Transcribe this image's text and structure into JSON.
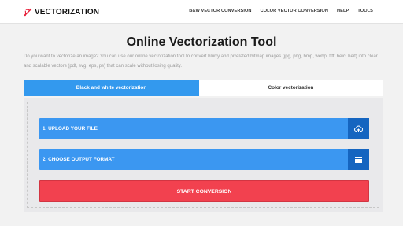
{
  "brand": {
    "name": "VECTORIZATION",
    "accent": "#e8203a"
  },
  "nav": {
    "items": [
      "B&W VECTOR CONVERSION",
      "COLOR VECTOR CONVERSION",
      "HELP",
      "TOOLS"
    ]
  },
  "main": {
    "title": "Online Vectorization Tool",
    "description": "Do you want to vectorize an image? You can use our online vectorization tool to convert blurry and pixelated bitmap images (jpg, png, bmp, webp, tiff, heic, heif) into clear and scalable vectors (pdf, svg, eps, ps) that can scale without losing quality."
  },
  "tabs": [
    {
      "label": "Black and white vectorization",
      "active": true
    },
    {
      "label": "Color vectorization",
      "active": false
    }
  ],
  "steps": {
    "upload_label": "1. UPLOAD YOUR FILE",
    "upload_icon": "cloud-upload-icon",
    "format_label": "2. CHOOSE OUTPUT FORMAT",
    "format_icon": "list-icon",
    "start_label": "START CONVERSION"
  },
  "colors": {
    "tab_active": "#3399ee",
    "step_button": "#3b97f1",
    "step_icon_bg": "#1565c0",
    "start_button": "#f2414f"
  }
}
